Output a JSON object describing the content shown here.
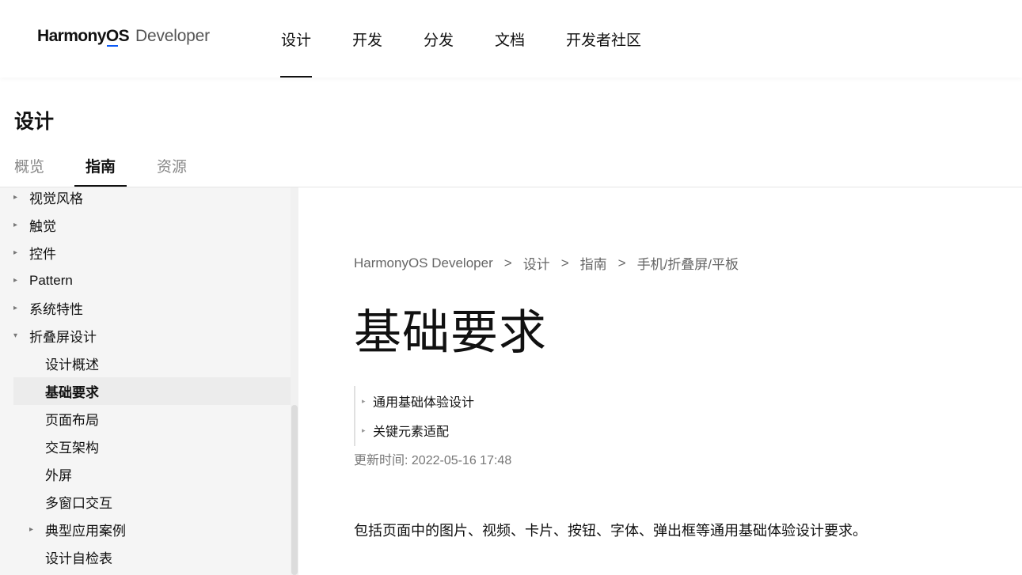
{
  "header": {
    "logo_brand_pre": "Harmony",
    "logo_brand_o": "O",
    "logo_brand_post": "S",
    "logo_suffix": "Developer",
    "nav": [
      "设计",
      "开发",
      "分发",
      "文档",
      "开发者社区"
    ],
    "active_nav": "设计"
  },
  "section": {
    "title": "设计",
    "tabs": [
      "概览",
      "指南",
      "资源"
    ],
    "active_tab": "指南"
  },
  "sidebar": {
    "items": [
      {
        "label": "视觉风格",
        "caret": "▸"
      },
      {
        "label": "触觉",
        "caret": "▸"
      },
      {
        "label": "控件",
        "caret": "▸"
      },
      {
        "label": "Pattern",
        "caret": "▸"
      },
      {
        "label": "系统特性",
        "caret": "▸"
      },
      {
        "label": "折叠屏设计",
        "caret": "▾"
      },
      {
        "label": "设计概述",
        "caret": ""
      },
      {
        "label": "基础要求",
        "caret": ""
      },
      {
        "label": "页面布局",
        "caret": ""
      },
      {
        "label": "交互架构",
        "caret": ""
      },
      {
        "label": "外屏",
        "caret": ""
      },
      {
        "label": "多窗口交互",
        "caret": ""
      },
      {
        "label": "典型应用案例",
        "caret": "▸"
      },
      {
        "label": "设计自检表",
        "caret": ""
      }
    ],
    "active_item": "基础要求"
  },
  "breadcrumb": [
    "HarmonyOS Developer",
    "设计",
    "指南",
    "手机/折叠屏/平板"
  ],
  "breadcrumb_separator": ">",
  "page_title": "基础要求",
  "toc": [
    {
      "label": "通用基础体验设计",
      "caret": "▸"
    },
    {
      "label": "关键元素适配",
      "caret": "▸"
    }
  ],
  "updated": "更新时间: 2022-05-16 17:48",
  "body_text": "包括页面中的图片、视频、卡片、按钮、字体、弹出框等通用基础体验设计要求。",
  "colors": {
    "accent": "#0a59f7",
    "sidebar_bg": "#f5f5f5",
    "active_row_bg": "#ececec"
  }
}
